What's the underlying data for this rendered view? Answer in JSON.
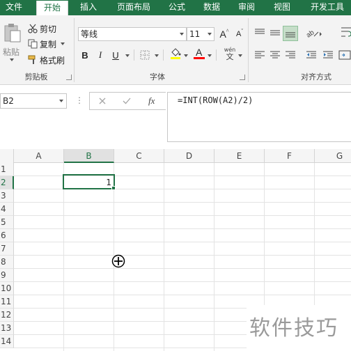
{
  "ribbon": {
    "tabs": [
      {
        "label": "文件",
        "active": false
      },
      {
        "label": "开始",
        "active": true
      },
      {
        "label": "插入",
        "active": false
      },
      {
        "label": "页面布局",
        "active": false
      },
      {
        "label": "公式",
        "active": false
      },
      {
        "label": "数据",
        "active": false
      },
      {
        "label": "审阅",
        "active": false
      },
      {
        "label": "视图",
        "active": false
      },
      {
        "label": "开发工具",
        "active": false
      }
    ],
    "clipboard": {
      "paste_label": "粘贴",
      "cut_label": "剪切",
      "copy_label": "复制",
      "format_painter_label": "格式刷",
      "group_label": "剪贴板"
    },
    "font": {
      "font_name": "等线",
      "font_size": "11",
      "bold_label": "B",
      "italic_label": "I",
      "underline_label": "U",
      "increase_font_label": "A",
      "decrease_font_label": "A",
      "font_color_label": "A",
      "phonetic_label": "wén",
      "phonetic_sub": "文",
      "group_label": "字体",
      "highlight_color": "#ffff00",
      "font_color": "#ff0000"
    },
    "alignment": {
      "group_label": "对齐方式"
    }
  },
  "formula_bar": {
    "name_box": "B2",
    "formula": "=INT(ROW(A2)/2)",
    "cancel_icon": "x-icon",
    "enter_icon": "check-icon",
    "function_label": "fx"
  },
  "sheet": {
    "columns": [
      "A",
      "B",
      "C",
      "D",
      "E",
      "F",
      "G"
    ],
    "rows": [
      "1",
      "2",
      "3",
      "4",
      "5",
      "6",
      "7",
      "8",
      "9",
      "10",
      "11",
      "12",
      "13",
      "14"
    ],
    "active_cell": "B2",
    "active_column": "B",
    "active_row": "2",
    "cells": {
      "B2": "1"
    }
  },
  "watermark": {
    "text": "软件技巧"
  },
  "theme": {
    "accent": "#217346"
  }
}
